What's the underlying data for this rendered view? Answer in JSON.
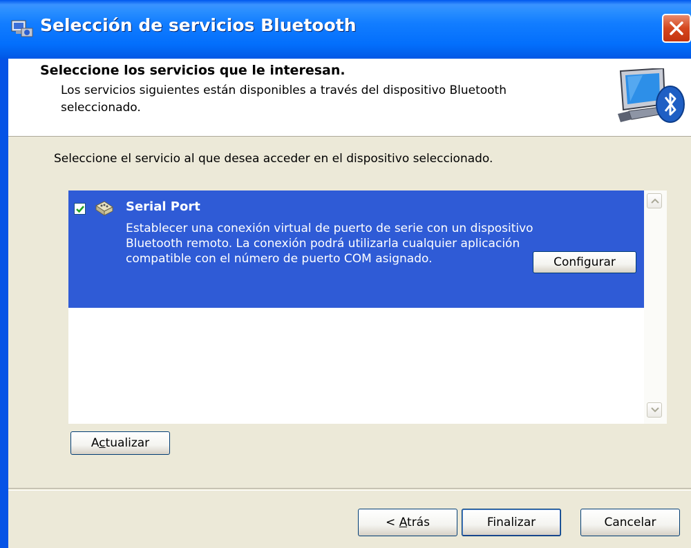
{
  "window": {
    "title": "Selección de servicios Bluetooth",
    "close_icon": "close-icon"
  },
  "header": {
    "title": "Seleccione los servicios que le interesan.",
    "description": "Los servicios siguientes están disponibles a través del dispositivo Bluetooth seleccionado.",
    "art_icon": "bluetooth-computer-icon"
  },
  "body": {
    "instruction": "Seleccione el servicio al que desea acceder en el dispositivo seleccionado."
  },
  "services": [
    {
      "name": "Serial Port",
      "checked": true,
      "icon": "serial-port-icon",
      "description": "Establecer una conexión virtual de puerto de serie con un dispositivo Bluetooth remoto. La conexión podrá utilizarla cualquier aplicación compatible con el número de puerto COM asignado.",
      "configure_label": "Configurar"
    }
  ],
  "buttons": {
    "update_pre": "A",
    "update_accel": "c",
    "update_post": "tualizar",
    "back_pre": "< ",
    "back_accel": "A",
    "back_post": "trás",
    "finish": "Finalizar",
    "cancel": "Cancelar"
  },
  "colors": {
    "titlebar": "#0a5ee8",
    "selection": "#2f5bd6",
    "dialog_bg": "#ece9d8",
    "close_button": "#d5471e"
  }
}
